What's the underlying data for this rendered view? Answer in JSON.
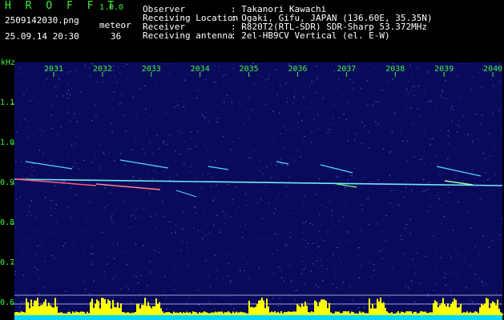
{
  "header": {
    "app_title": "H R O F F T",
    "app_version": "1.0.0",
    "file_name": "2509142030.png",
    "date_time": "25.09.14 20:30",
    "meteor_label": "meteor",
    "meteor_count": "36"
  },
  "info": [
    {
      "label": "Observer",
      "value": ": Takanori Kawachi"
    },
    {
      "label": "Receiving Location",
      "value": ": Ogaki, Gifu, JAPAN (136.60E, 35.35N)"
    },
    {
      "label": "Receiver",
      "value": ": R820T2(RTL-SDR) SDR-Sharp 53.372MHz"
    },
    {
      "label": "Receiving antenna",
      "value": ": 2el-HB9CV Vertical (el. E-W)"
    }
  ],
  "spectrogram": {
    "y_unit": "kHz",
    "y_ticks": [
      "1.1",
      "1.0",
      "0.9",
      "0.8",
      "0.7",
      "0.6"
    ],
    "x_ticks": [
      "2031",
      "2032",
      "2033",
      "2034",
      "2035",
      "2036",
      "2037",
      "2038",
      "2039",
      "2040"
    ],
    "colors": {
      "text": "#3df23d",
      "background": "#0a0a5a",
      "carrier": "#6fe8ff",
      "histogram": "#ffff00",
      "baseline": "#00d8ff"
    }
  }
}
